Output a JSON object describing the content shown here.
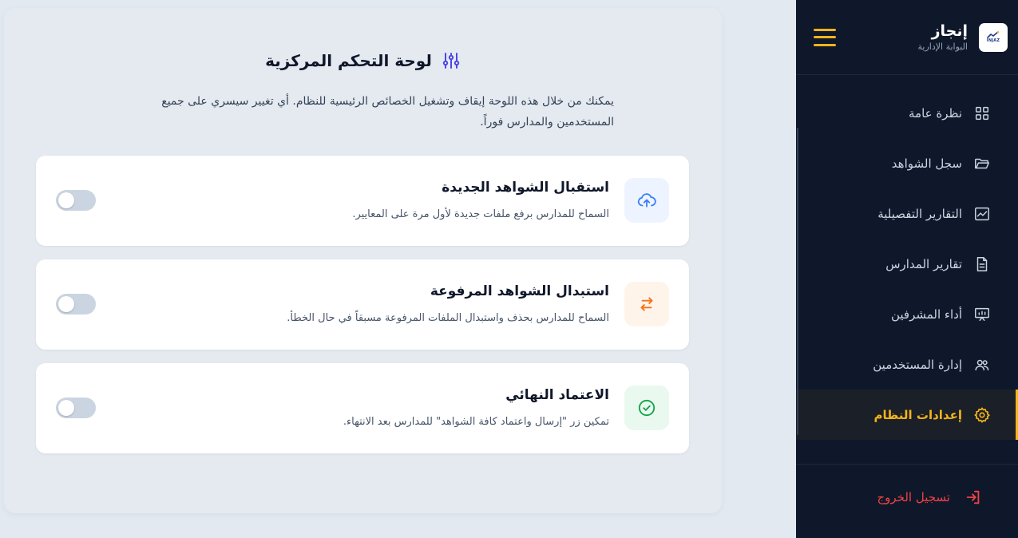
{
  "brand": {
    "name": "إنجاز",
    "subtitle": "البوابة الإدارية",
    "logo_text": "INJAZ"
  },
  "sidebar": {
    "items": [
      {
        "label": "نظرة عامة",
        "icon": "grid-icon",
        "active": false
      },
      {
        "label": "سجل الشواهد",
        "icon": "folder-open-icon",
        "active": false
      },
      {
        "label": "التقارير التفصيلية",
        "icon": "line-chart-icon",
        "active": false
      },
      {
        "label": "تقارير المدارس",
        "icon": "document-icon",
        "active": false
      },
      {
        "label": "أداء المشرفين",
        "icon": "presentation-icon",
        "active": false
      },
      {
        "label": "إدارة المستخدمين",
        "icon": "users-icon",
        "active": false
      },
      {
        "label": "إعدادات النظام",
        "icon": "gear-icon",
        "active": true
      }
    ],
    "logout_label": "تسجيل الخروج"
  },
  "main": {
    "title": "لوحة التحكم المركزية",
    "description": "يمكنك من خلال هذه اللوحة إيقاف وتشغيل الخصائص الرئيسية للنظام. أي تغيير سيسري على جميع المستخدمين والمدارس فوراً.",
    "cards": [
      {
        "title": "استقبال الشواهد الجديدة",
        "description": "السماح للمدارس برفع ملفات جديدة لأول مرة على المعايير.",
        "icon": "cloud-upload-icon",
        "enabled": false
      },
      {
        "title": "استبدال الشواهد المرفوعة",
        "description": "السماح للمدارس بحذف واستبدال الملفات المرفوعة مسبقاً في حال الخطأ.",
        "icon": "swap-arrows-icon",
        "enabled": false
      },
      {
        "title": "الاعتماد النهائي",
        "description": "تمكين زر \"إرسال واعتماد كافة الشواهد\" للمدارس بعد الانتهاء.",
        "icon": "check-circle-icon",
        "enabled": false
      }
    ]
  },
  "colors": {
    "sidebar_bg": "#0f172a",
    "accent": "#f5b41b",
    "danger": "#ef4444",
    "page_bg": "#e3e9f1",
    "title_icon": "#4f46e5"
  }
}
